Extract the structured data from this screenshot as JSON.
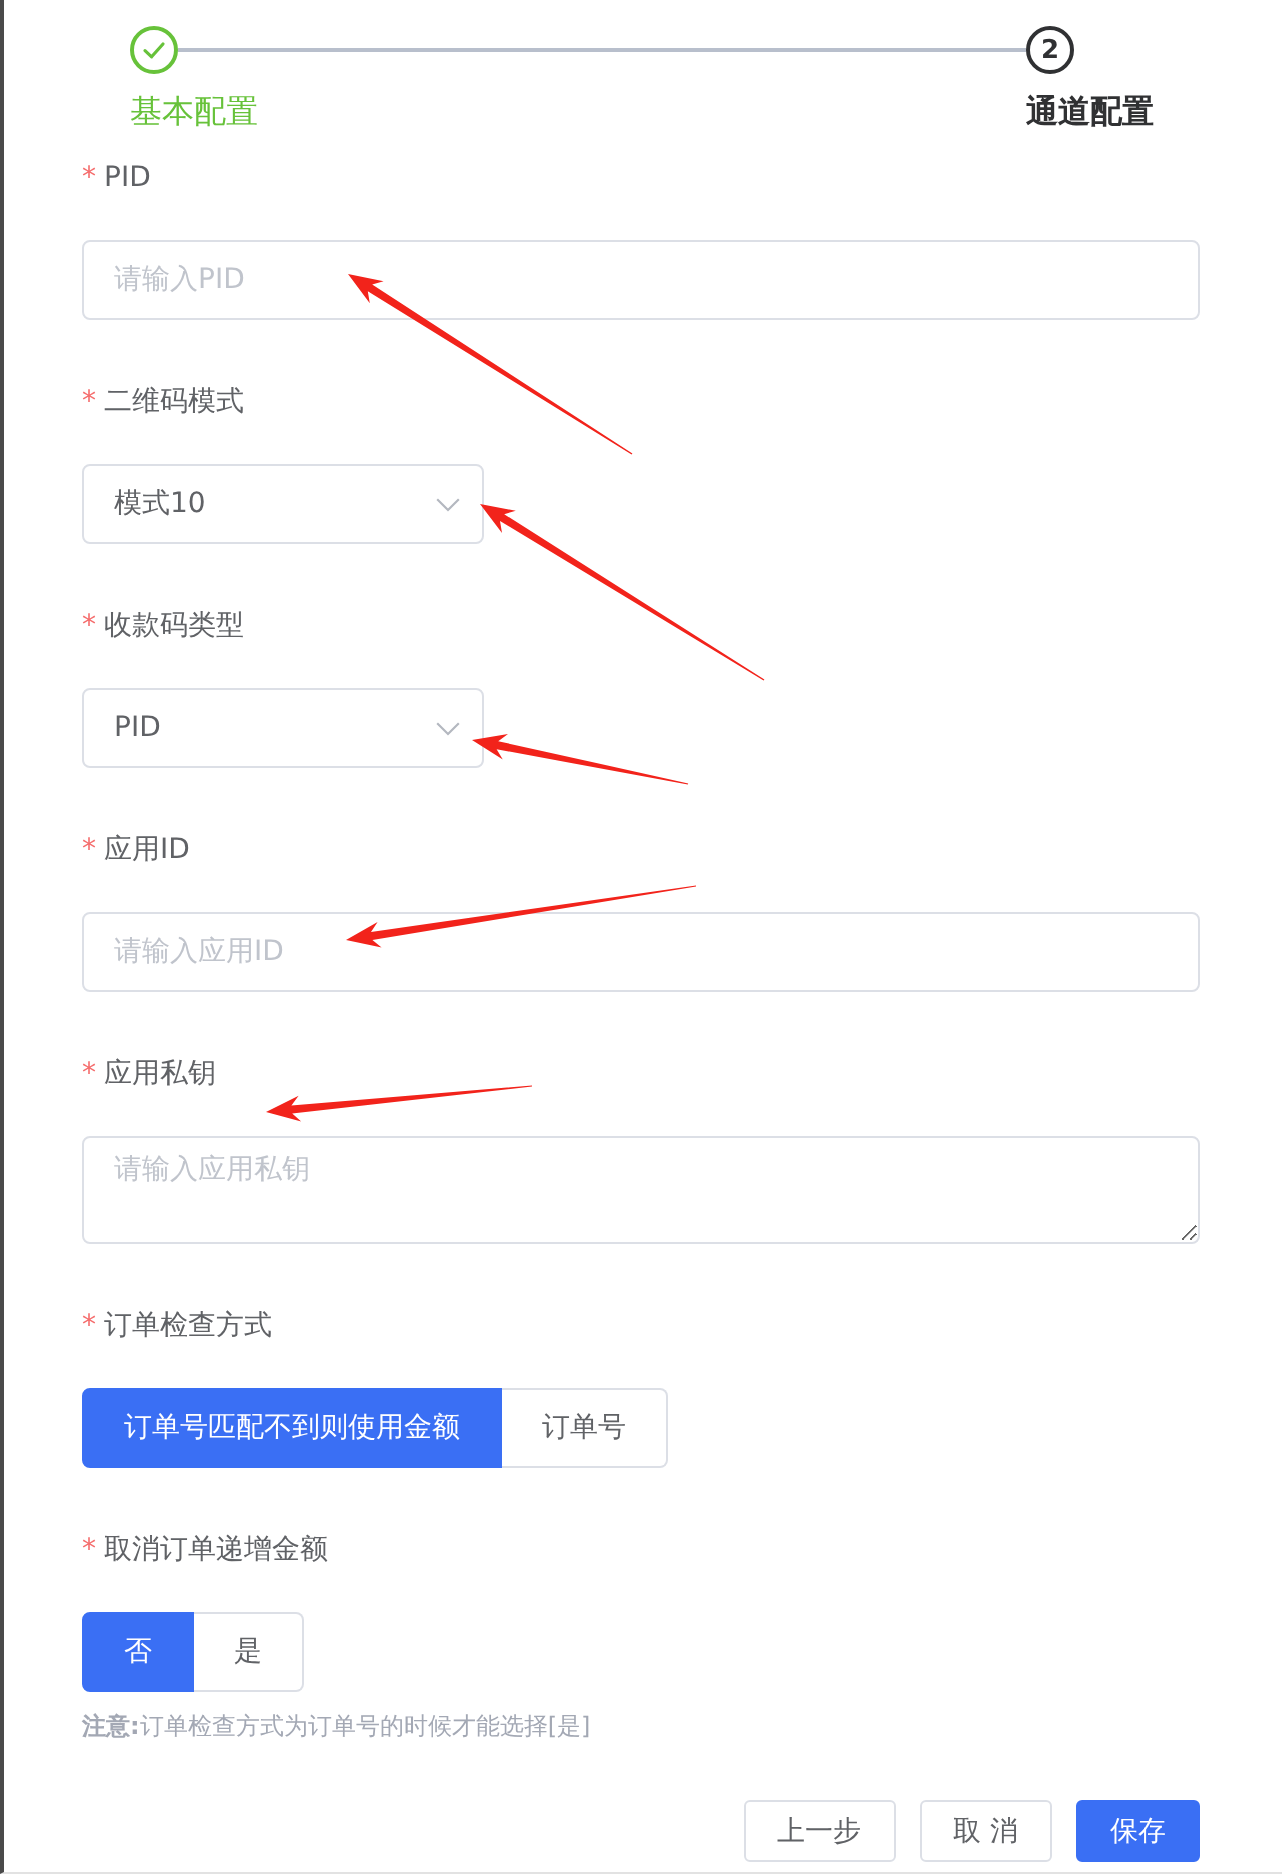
{
  "steps": [
    {
      "label": "基本配置",
      "completed": true,
      "active": false
    },
    {
      "number": "2",
      "label": "通道配置",
      "completed": false,
      "active": true
    }
  ],
  "fields": [
    {
      "kind": "input",
      "required_mark": "*",
      "label": "PID",
      "placeholder": "请输入PID"
    },
    {
      "kind": "select",
      "required_mark": "*",
      "label": "二维码模式",
      "value": "模式10"
    },
    {
      "kind": "select",
      "required_mark": "*",
      "label": "收款码类型",
      "value": "PID"
    },
    {
      "kind": "input",
      "required_mark": "*",
      "label": "应用ID",
      "placeholder": "请输入应用ID"
    },
    {
      "kind": "textarea",
      "required_mark": "*",
      "label": "应用私钥",
      "placeholder": "请输入应用私钥"
    },
    {
      "kind": "radio",
      "required_mark": "*",
      "label": "订单检查方式",
      "options": [
        {
          "label": "订单号匹配不到则使用金额",
          "selected": true
        },
        {
          "label": "订单号",
          "selected": false
        }
      ]
    },
    {
      "kind": "radio",
      "required_mark": "*",
      "label": "取消订单递增金额",
      "options": [
        {
          "label": "否",
          "selected": true
        },
        {
          "label": "是",
          "selected": false
        }
      ],
      "hint": "**注意:**订单检查方式为订单号的时候才能选择[是]"
    }
  ],
  "buttons": [
    {
      "label": "上一步",
      "kind": "default"
    },
    {
      "label": "取 消",
      "kind": "default"
    },
    {
      "label": "保存",
      "kind": "primary"
    }
  ]
}
